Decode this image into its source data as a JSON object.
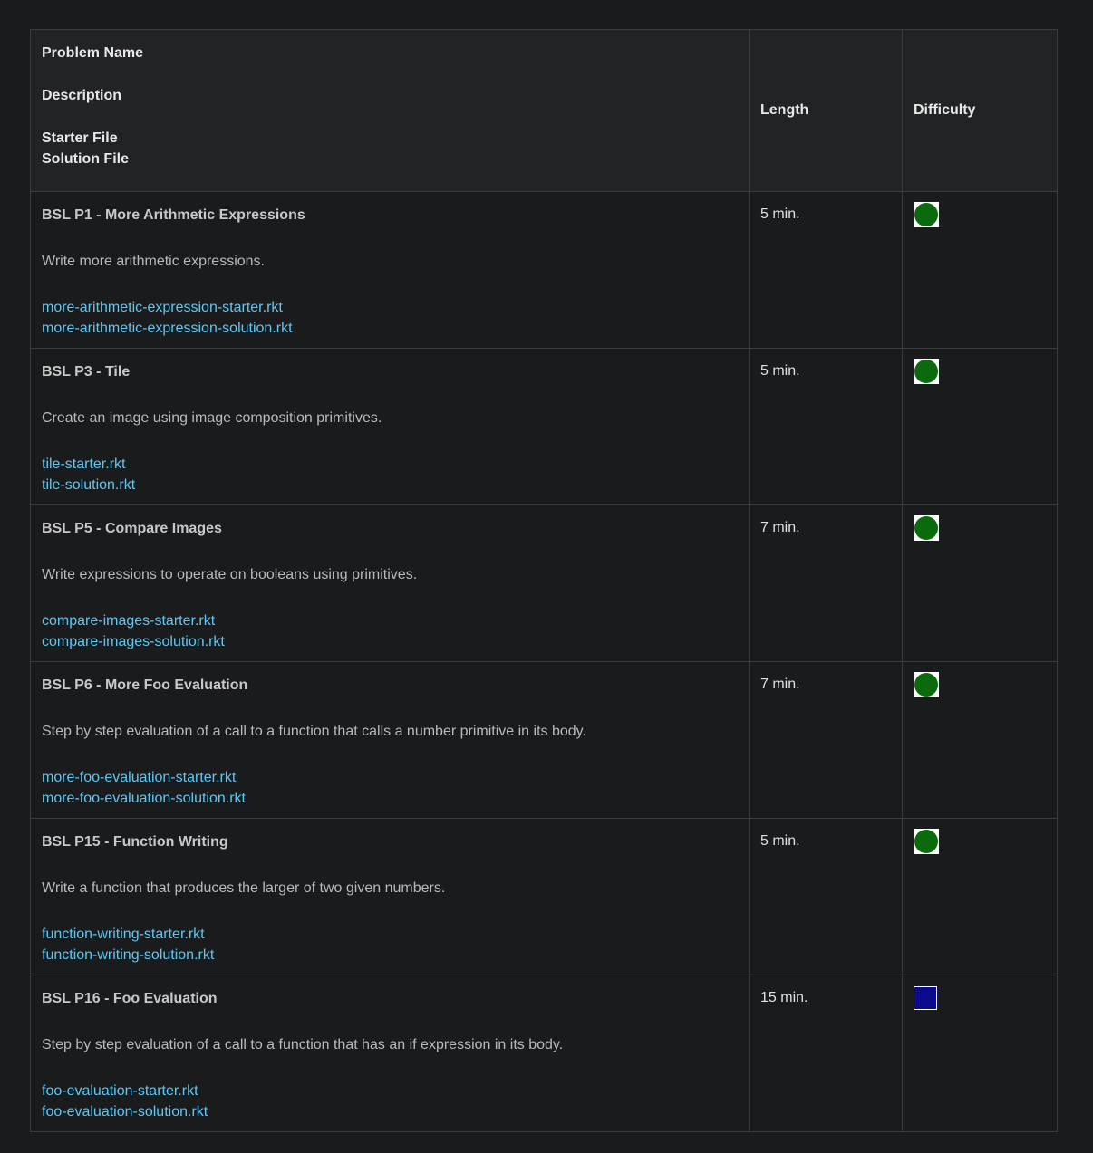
{
  "header": {
    "col1_lines": [
      "Problem Name",
      "Description",
      "Starter File",
      "Solution File"
    ],
    "length": "Length",
    "difficulty": "Difficulty"
  },
  "colors": {
    "easy": "#0b6a0b",
    "medium": "#0a0a8c",
    "link": "#5ec7f2",
    "background": "#1a1b1d"
  },
  "rows": [
    {
      "name": "BSL P1 - More Arithmetic Expressions",
      "description": "Write more arithmetic expressions.",
      "starter": "more-arithmetic-expression-starter.rkt",
      "solution": "more-arithmetic-expression-solution.rkt",
      "length": "5 min.",
      "difficulty_icon": "green-circle-icon"
    },
    {
      "name": "BSL P3 - Tile",
      "description": "Create an image using image composition primitives.",
      "starter": "tile-starter.rkt",
      "solution": "tile-solution.rkt",
      "length": "5 min.",
      "difficulty_icon": "green-circle-icon"
    },
    {
      "name": "BSL P5 - Compare Images",
      "description": "Write expressions to operate on booleans using primitives.",
      "starter": "compare-images-starter.rkt",
      "solution": "compare-images-solution.rkt",
      "length": "7 min.",
      "difficulty_icon": "green-circle-icon"
    },
    {
      "name": "BSL P6 - More Foo Evaluation",
      "description": "Step by step evaluation of a call to a function that calls a number primitive in its body.",
      "starter": "more-foo-evaluation-starter.rkt",
      "solution": "more-foo-evaluation-solution.rkt",
      "length": "7 min.",
      "difficulty_icon": "green-circle-icon"
    },
    {
      "name": "BSL P15 - Function Writing",
      "description": "Write a function that produces the larger of two given numbers.",
      "starter": "function-writing-starter.rkt",
      "solution": "function-writing-solution.rkt",
      "length": "5 min.",
      "difficulty_icon": "green-circle-icon"
    },
    {
      "name": "BSL P16 - Foo Evaluation",
      "description": "Step by step evaluation of a call to a function that has an if expression in its body.",
      "starter": "foo-evaluation-starter.rkt",
      "solution": "foo-evaluation-solution.rkt",
      "length": "15 min.",
      "difficulty_icon": "blue-square-icon"
    }
  ]
}
